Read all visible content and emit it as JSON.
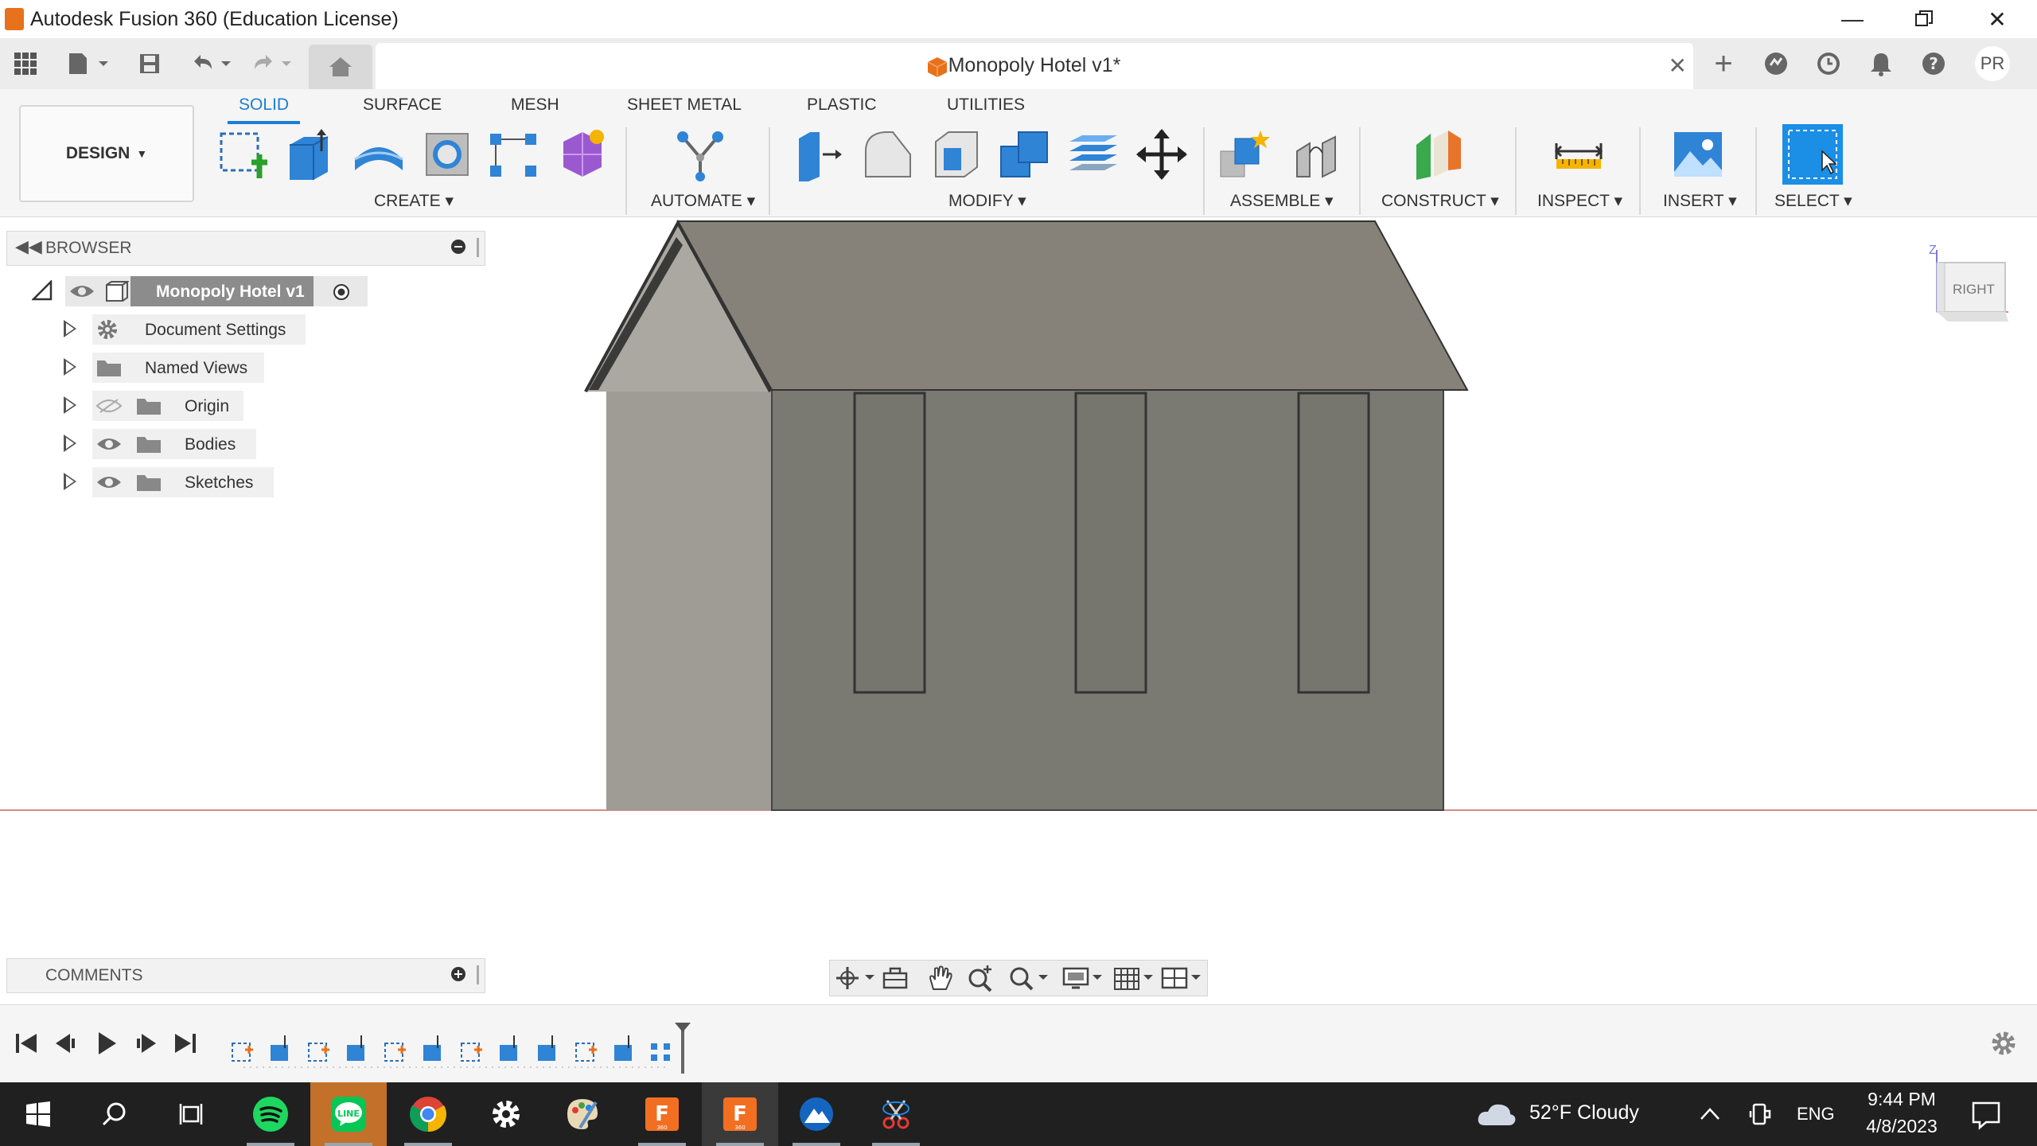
{
  "app": {
    "title": "Autodesk Fusion 360 (Education License)",
    "document_tab": "Monopoly Hotel v1*",
    "user_initials": "PR"
  },
  "ribbon": {
    "workspace": "DESIGN",
    "tabs": [
      "SOLID",
      "SURFACE",
      "MESH",
      "SHEET METAL",
      "PLASTIC",
      "UTILITIES"
    ],
    "active_tab": "SOLID",
    "groups": [
      "CREATE",
      "AUTOMATE",
      "MODIFY",
      "ASSEMBLE",
      "CONSTRUCT",
      "INSPECT",
      "INSERT",
      "SELECT"
    ]
  },
  "browser": {
    "label": "BROWSER",
    "root": "Monopoly Hotel v1",
    "items": [
      "Document Settings",
      "Named Views",
      "Origin",
      "Bodies",
      "Sketches"
    ]
  },
  "viewcube": {
    "face": "RIGHT",
    "axis_label": "Z"
  },
  "comments": {
    "label": "COMMENTS"
  },
  "taskbar": {
    "weather": "52°F  Cloudy",
    "language": "ENG",
    "time": "9:44 PM",
    "date": "4/8/2023"
  },
  "colors": {
    "accent": "#1b7ed6",
    "model_body": "#7a7a73",
    "roof": "#86827a",
    "ground_line": "#d88a8a"
  }
}
